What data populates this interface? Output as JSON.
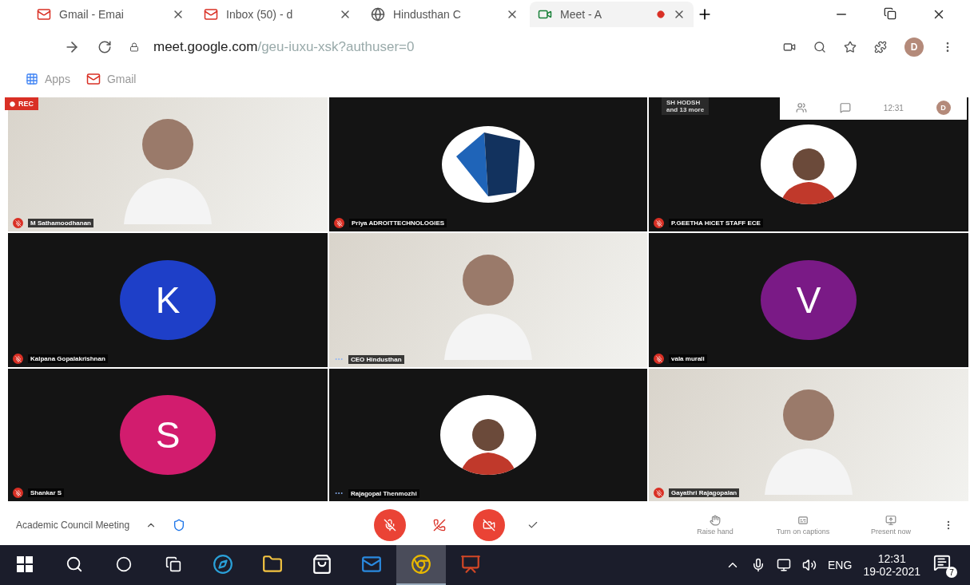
{
  "tabs": [
    {
      "title": "Gmail - Emai",
      "selected": false
    },
    {
      "title": "Inbox (50) - d",
      "selected": false
    },
    {
      "title": "Hindusthan C",
      "selected": false
    },
    {
      "title": "Meet - A",
      "selected": true,
      "recording": true
    }
  ],
  "address": {
    "host": "meet.google.com",
    "path": "/geu-iuxu-xsk?authuser=0"
  },
  "profile": "D",
  "bookmarks": [
    {
      "label": "Apps"
    },
    {
      "label": "Gmail"
    }
  ],
  "meet_top": {
    "rec": "REC",
    "presenter": "SH HODSH",
    "more": "and 13 more",
    "time": "12:31",
    "profile": "D"
  },
  "tiles": [
    {
      "name": "M Sathamoodhanan",
      "kind": "video",
      "muted": true
    },
    {
      "name": "Priya ADROITTECHNOLOGIES",
      "kind": "logo",
      "muted": true
    },
    {
      "name": "P.GEETHA HICET STAFF ECE",
      "kind": "picture",
      "muted": true
    },
    {
      "name": "Kalpana Gopalakrishnan",
      "kind": "letter",
      "letter": "K",
      "color": "#1e3fc8",
      "muted": true
    },
    {
      "name": "CEO Hindusthan",
      "kind": "video",
      "muted": false
    },
    {
      "name": "vala murali",
      "kind": "letter",
      "letter": "V",
      "color": "#7a1a86",
      "muted": true
    },
    {
      "name": "Shankar S",
      "kind": "letter",
      "letter": "S",
      "color": "#d21c6e",
      "muted": true
    },
    {
      "name": "Rajagopal Thenmozhi",
      "kind": "picture",
      "muted": false
    },
    {
      "name": "Gayathri Rajagopalan",
      "kind": "video",
      "muted": true
    }
  ],
  "meeting": {
    "title": "Academic Council Meeting",
    "mic_on": false,
    "camera_on": false,
    "actions": [
      {
        "label": "Raise hand"
      },
      {
        "label": "Turn on captions"
      },
      {
        "label": "Present now"
      }
    ]
  },
  "taskbar": {
    "language": "ENG",
    "time": "12:31",
    "date": "19-02-2021",
    "notifications": "7",
    "apps": [
      {
        "selected": false
      },
      {
        "selected": false
      },
      {
        "selected": false
      },
      {
        "selected": false
      },
      {
        "selected": true
      },
      {
        "selected": false
      }
    ]
  }
}
